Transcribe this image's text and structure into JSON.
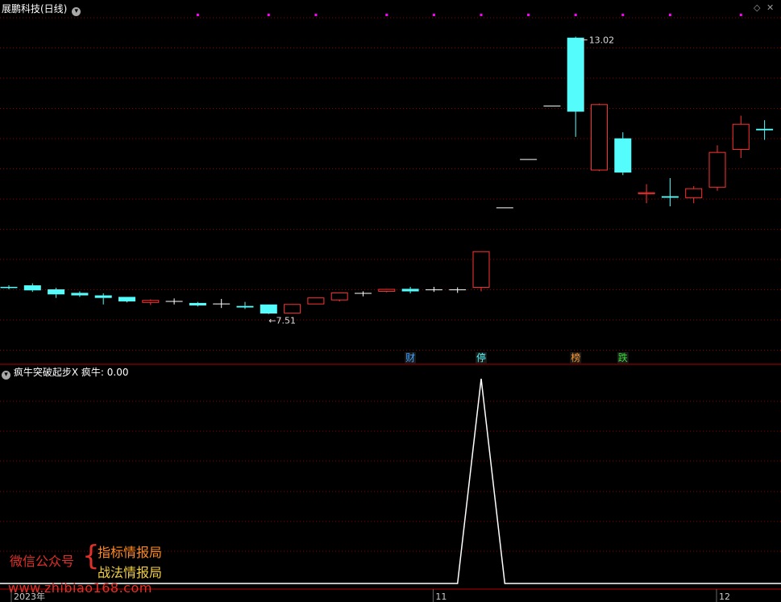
{
  "header": {
    "stock_title": "展鹏科技(日线)",
    "indicator_title": "疯牛突破起步X",
    "indicator_label": "疯牛: 0.00"
  },
  "watermark": {
    "left_text": "微信公众号",
    "line1": "指标情报局",
    "line2": "战法情报局",
    "site": "www.zhibiao168.com"
  },
  "colors": {
    "up": "#ff3232",
    "down": "#54fcfc",
    "neutral": "#ffffff",
    "grid": "#8b0000",
    "marker": "#ff00ff",
    "divider": "#b00000"
  },
  "chart_data": [
    {
      "type": "candlestick",
      "ylim": [
        6.8,
        13.3
      ],
      "max_label": "13.02",
      "min_label": "7.51",
      "grid": true,
      "candles": [
        {
          "o": 8.05,
          "h": 8.08,
          "l": 8.0,
          "c": 8.03
        },
        {
          "o": 8.08,
          "h": 8.12,
          "l": 7.95,
          "c": 7.98
        },
        {
          "o": 8.0,
          "h": 8.03,
          "l": 7.83,
          "c": 7.9
        },
        {
          "o": 7.93,
          "h": 7.96,
          "l": 7.85,
          "c": 7.88
        },
        {
          "o": 7.88,
          "h": 7.92,
          "l": 7.7,
          "c": 7.83
        },
        {
          "o": 7.85,
          "h": 7.85,
          "l": 7.74,
          "c": 7.76
        },
        {
          "o": 7.74,
          "h": 7.8,
          "l": 7.69,
          "c": 7.78
        },
        {
          "o": 7.76,
          "h": 7.82,
          "l": 7.7,
          "c": 7.76
        },
        {
          "o": 7.73,
          "h": 7.75,
          "l": 7.66,
          "c": 7.68
        },
        {
          "o": 7.71,
          "h": 7.81,
          "l": 7.63,
          "c": 7.71
        },
        {
          "o": 7.67,
          "h": 7.75,
          "l": 7.61,
          "c": 7.64
        },
        {
          "o": 7.7,
          "h": 7.7,
          "l": 7.51,
          "c": 7.52
        },
        {
          "o": 7.53,
          "h": 7.7,
          "l": 7.53,
          "c": 7.7
        },
        {
          "o": 7.71,
          "h": 7.83,
          "l": 7.71,
          "c": 7.83
        },
        {
          "o": 7.79,
          "h": 7.93,
          "l": 7.76,
          "c": 7.93
        },
        {
          "o": 7.92,
          "h": 7.96,
          "l": 7.86,
          "c": 7.92
        },
        {
          "o": 7.96,
          "h": 8.01,
          "l": 7.94,
          "c": 8.0
        },
        {
          "o": 8.01,
          "h": 8.05,
          "l": 7.92,
          "c": 7.96
        },
        {
          "o": 7.99,
          "h": 8.05,
          "l": 7.95,
          "c": 7.99
        },
        {
          "o": 7.99,
          "h": 8.04,
          "l": 7.93,
          "c": 7.99
        },
        {
          "o": 8.04,
          "h": 8.75,
          "l": 7.96,
          "c": 8.75
        },
        {
          "o": 9.62,
          "h": 9.62,
          "l": 9.62,
          "c": 9.62
        },
        {
          "o": 10.58,
          "h": 10.58,
          "l": 10.58,
          "c": 10.58
        },
        {
          "o": 11.64,
          "h": 11.64,
          "l": 11.64,
          "c": 11.64
        },
        {
          "o": 13.0,
          "h": 13.02,
          "l": 11.03,
          "c": 11.53
        },
        {
          "o": 10.37,
          "h": 11.69,
          "l": 10.35,
          "c": 11.67
        },
        {
          "o": 11.0,
          "h": 11.12,
          "l": 10.27,
          "c": 10.32
        },
        {
          "o": 9.9,
          "h": 10.09,
          "l": 9.71,
          "c": 9.92
        },
        {
          "o": 9.85,
          "h": 10.21,
          "l": 9.65,
          "c": 9.82
        },
        {
          "o": 9.82,
          "h": 10.05,
          "l": 9.71,
          "c": 10.0
        },
        {
          "o": 10.03,
          "h": 10.86,
          "l": 9.96,
          "c": 10.72
        },
        {
          "o": 10.78,
          "h": 11.45,
          "l": 10.61,
          "c": 11.28
        },
        {
          "o": 11.19,
          "h": 11.36,
          "l": 10.97,
          "c": 11.16
        }
      ],
      "events": [
        {
          "index": 17,
          "label": "财",
          "color": "#3fa0ff"
        },
        {
          "index": 20,
          "label": "停",
          "color": "#54fcfc"
        },
        {
          "index": 24,
          "label": "榜",
          "color": "#ff9a2a"
        },
        {
          "index": 26,
          "label": "跌",
          "color": "#33dd33"
        }
      ],
      "top_markers": [
        8,
        11,
        13,
        16,
        18,
        20,
        22,
        24,
        26,
        28,
        31
      ]
    },
    {
      "type": "line",
      "ylim": [
        0,
        1
      ],
      "series": [
        {
          "values": [
            0,
            0,
            0,
            0,
            0,
            0,
            0,
            0,
            0,
            0,
            0,
            0,
            0,
            0,
            0,
            0,
            0,
            0,
            0,
            0,
            1,
            0,
            0,
            0,
            0,
            0,
            0,
            0,
            0,
            0,
            0,
            0,
            0,
            0
          ],
          "color": "#ffffff"
        }
      ],
      "x_labels": [
        {
          "index": 0,
          "text": "2023年"
        },
        {
          "index": 18,
          "text": "11"
        },
        {
          "index": 30,
          "text": "12"
        }
      ]
    }
  ]
}
